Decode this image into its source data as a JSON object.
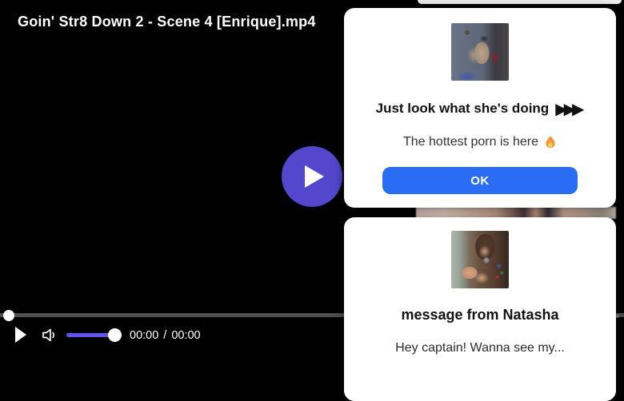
{
  "player": {
    "title": "Goin' Str8 Down 2 - Scene 4 [Enrique].mp4",
    "current_time": "00:00",
    "time_separator": "/",
    "duration": "00:00",
    "icons": {
      "center_play": "play-icon",
      "play_control": "play-icon",
      "volume_control": "speaker-icon"
    }
  },
  "overlay_top_popup": {
    "thumbnail": "webcam-couple-photo",
    "heading": "Just look what she's doing",
    "heading_arrows": "▶▶▶",
    "subtext": "The hottest porn is here",
    "subtext_emoji": "🔥",
    "ok_label": "OK"
  },
  "overlay_bottom_popup": {
    "thumbnail": "selfie-photo",
    "heading": "message from Natasha",
    "message": "Hey captain! Wanna see my..."
  },
  "colors": {
    "page_background": "#000000",
    "popup_background": "#ffffff",
    "accent_blue": "#2a6cf4",
    "play_button_purple": "#5347cd",
    "volume_slider_purple": "#6054e8",
    "progress_track_gray": "#4f4f4f",
    "top_card_strip_gray": "#ededed"
  }
}
